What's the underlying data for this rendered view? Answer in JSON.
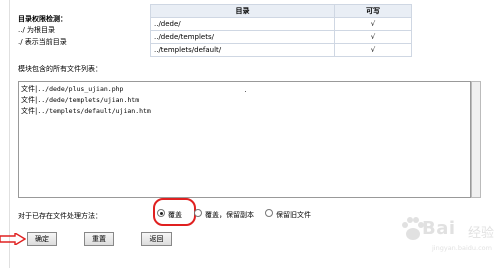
{
  "permissions": {
    "title": "目录权限检测：",
    "note_root": "../ 为根目录",
    "note_current": "./ 表示当前目录",
    "columns": [
      "目录",
      "可写"
    ],
    "rows": [
      {
        "path": "../dede/",
        "writable": "√"
      },
      {
        "path": "../dede/templets/",
        "writable": "√"
      },
      {
        "path": "../templets/default/",
        "writable": "√"
      }
    ]
  },
  "files": {
    "label": "模块包含的所有文件列表：",
    "items": [
      {
        "prefix": "文件|",
        "path": "../dede/plus_ujian.php"
      },
      {
        "prefix": "文件|",
        "path": "../dede/templets/ujian.htm"
      },
      {
        "prefix": "文件|",
        "path": "../templets/default/ujian.htm"
      }
    ]
  },
  "overwrite": {
    "label": "对于已存在文件处理方法：",
    "options": [
      {
        "label": "覆盖",
        "checked": true
      },
      {
        "label": "覆盖，保留副本",
        "checked": false
      },
      {
        "label": "保留旧文件",
        "checked": false
      }
    ]
  },
  "buttons": {
    "confirm": "确定",
    "reset": "重置",
    "back": "返回"
  },
  "watermark": {
    "brand": "Bai",
    "brand_suffix": "经验",
    "url": "jingyan.baidu.com"
  },
  "colors": {
    "highlight": "#e02020",
    "table_header": "#e9eef5",
    "border": "#cfd7e3"
  }
}
